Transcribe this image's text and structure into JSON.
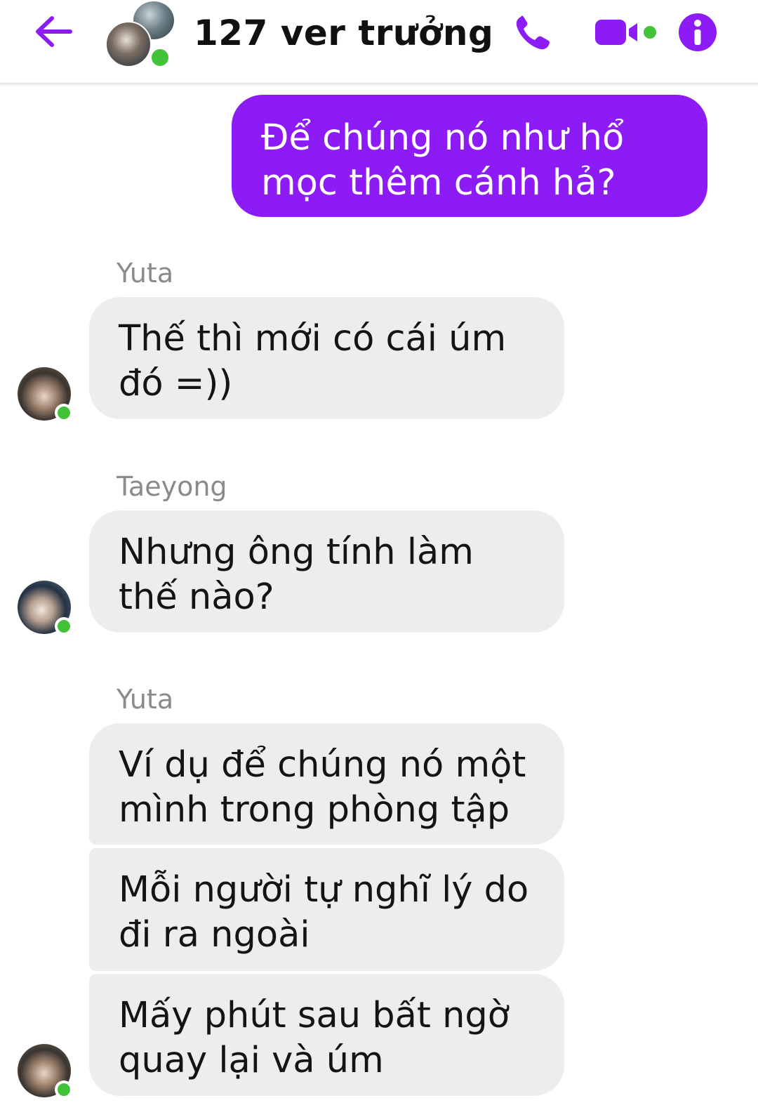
{
  "header": {
    "title": "127 ver trưởng",
    "accent_color": "#8c1bf5",
    "online_color": "#42c238",
    "icons": {
      "back": "back-arrow-icon",
      "call": "phone-icon",
      "video": "video-camera-icon",
      "info": "info-icon"
    }
  },
  "messages": [
    {
      "direction": "outgoing",
      "text": "Để chúng nó như hổ mọc thêm cánh hả?"
    },
    {
      "direction": "incoming",
      "sender": "Yuta",
      "text": "Thế thì mới có cái úm đó =))"
    },
    {
      "direction": "incoming",
      "sender": "Taeyong",
      "text": "Nhưng ông tính làm thế nào?"
    },
    {
      "direction": "incoming",
      "sender": "Yuta",
      "text": "Ví dụ để chúng nó một mình trong phòng tập"
    },
    {
      "direction": "incoming",
      "sender": "Yuta",
      "text": "Mỗi người tự nghĩ lý do đi ra ngoài"
    },
    {
      "direction": "incoming",
      "sender": "Yuta",
      "text": "Mấy phút sau bất ngờ quay lại và úm"
    }
  ]
}
